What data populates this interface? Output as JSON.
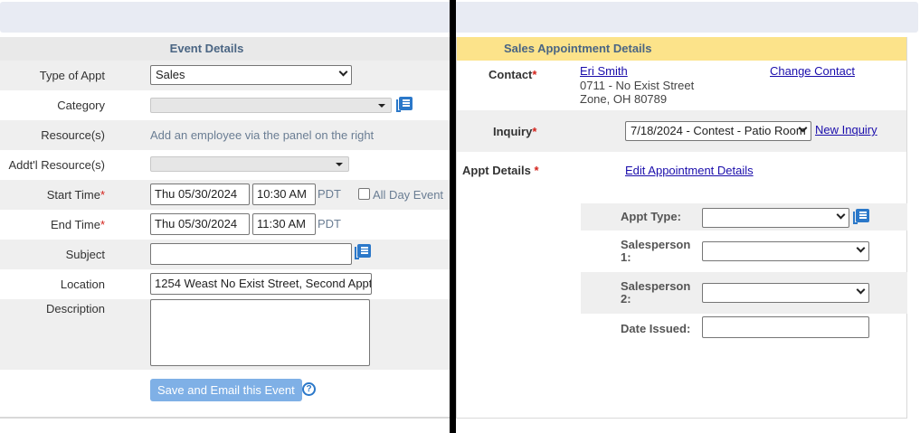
{
  "event": {
    "header": "Event Details",
    "type_of_appt": {
      "label": "Type of Appt",
      "value": "Sales"
    },
    "category": {
      "label": "Category",
      "value": ""
    },
    "resources": {
      "label": "Resource(s)",
      "hint": "Add an employee via the panel on the right"
    },
    "addtl_resources": {
      "label": "Addt'l Resource(s)",
      "value": ""
    },
    "start_time": {
      "label": "Start Time",
      "date": "Thu 05/30/2024",
      "time": "10:30 AM",
      "tz": "PDT",
      "all_day_label": "All Day Event"
    },
    "end_time": {
      "label": "End Time",
      "date": "Thu 05/30/2024",
      "time": "11:30 AM",
      "tz": "PDT"
    },
    "subject": {
      "label": "Subject",
      "value": ""
    },
    "location": {
      "label": "Location",
      "value": "1254 Weast No Exist Street, Second Appt"
    },
    "description": {
      "label": "Description",
      "value": ""
    },
    "save_button": "Save and Email this Event",
    "help_glyph": "?",
    "required_mark": "*"
  },
  "sales": {
    "header": "Sales Appointment Details",
    "contact": {
      "label": "Contact",
      "name": "Eri Smith",
      "address1": "0711 - No Exist Street",
      "address2": "Zone, OH 80789",
      "change_link": "Change Contact"
    },
    "inquiry": {
      "label": "Inquiry",
      "value": "7/18/2024 - Contest - Patio Room",
      "new_link": "New Inquiry"
    },
    "appt_details": {
      "label": "Appt Details",
      "edit_link": "Edit Appointment Details"
    },
    "appt_type": {
      "label": "Appt Type:",
      "value": ""
    },
    "salesperson1": {
      "label1": "Salesperson",
      "label2": "1:",
      "value": ""
    },
    "salesperson2": {
      "label1": "Salesperson",
      "label2": "2:",
      "value": ""
    },
    "date_issued": {
      "label": "Date Issued:",
      "value": ""
    }
  },
  "colors": {
    "accent_blue": "#2b78c9",
    "required_red": "#d4231c",
    "header_yellow": "#fce38a",
    "button_blue": "#7fb0e6"
  }
}
